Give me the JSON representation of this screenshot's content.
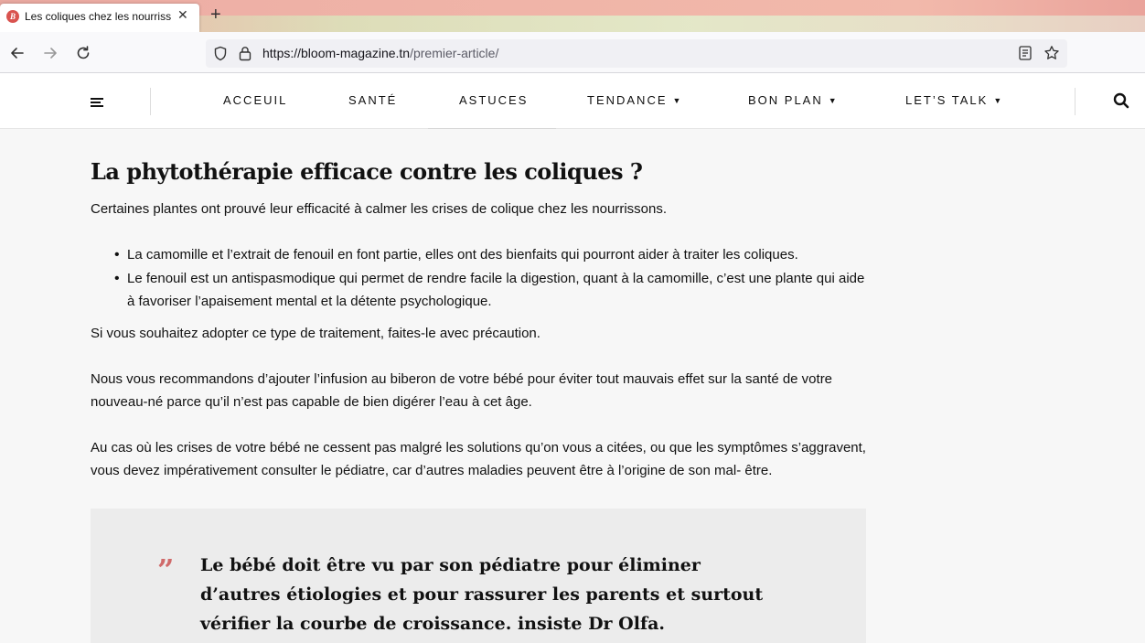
{
  "browser": {
    "tab_title": "Les coliques chez les nourrissons",
    "tab_favicon_letter": "B",
    "url_domain": "https://bloom-magazine.tn",
    "url_path": "/premier-article/"
  },
  "site_nav": {
    "items": [
      {
        "label": "ACCEUIL",
        "dropdown": false
      },
      {
        "label": "SANTÉ",
        "dropdown": false
      },
      {
        "label": "ASTUCES",
        "dropdown": false
      },
      {
        "label": "TENDANCE",
        "dropdown": true
      },
      {
        "label": "BON PLAN",
        "dropdown": true
      },
      {
        "label": "LET’S TALK",
        "dropdown": true
      }
    ]
  },
  "article": {
    "heading": "La phytothérapie efficace contre les coliques ?",
    "intro": "Certaines plantes ont prouvé leur efficacité à calmer les crises de colique chez les nourrissons.",
    "bullets": [
      "La camomille et l’extrait de fenouil en font partie, elles ont des bienfaits qui pourront aider à traiter les coliques.",
      "Le fenouil est un antispasmodique qui permet de rendre facile la digestion, quant à la camomille, c’est une plante qui aide à favoriser l’apaisement mental et la détente psychologique."
    ],
    "para1": "Si vous souhaitez adopter ce type de traitement, faites-le avec précaution.",
    "para2": "Nous vous recommandons d’ajouter l’infusion au biberon de votre bébé pour éviter tout mauvais effet sur la santé de votre nouveau-né parce qu’il n’est pas capable de bien digérer l’eau à cet âge.",
    "para3": "Au cas où les crises de votre bébé ne cessent pas malgré les solutions qu’on vous a citées, ou que les symptômes s’aggravent, vous devez impérativement consulter le pédiatre, car d’autres maladies peuvent être à l’origine de son mal- être.",
    "quote_mark": "”",
    "quote": " Le bébé doit être vu par son pédiatre pour éliminer d’autres étiologies et pour rassurer les parents et surtout vérifier la courbe de croissance.  insiste Dr Olfa."
  },
  "colors": {
    "accent_quote": "#d06a6a",
    "quote_bg": "#ececec"
  }
}
